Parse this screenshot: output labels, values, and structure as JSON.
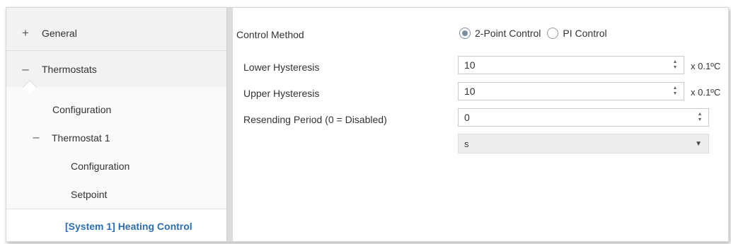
{
  "sidebar": {
    "items": [
      {
        "symbol": "+",
        "label": "General"
      },
      {
        "symbol": "–",
        "label": "Thermostats"
      }
    ],
    "subitems": [
      {
        "label": "Configuration"
      },
      {
        "symbol": "–",
        "label": "Thermostat 1"
      },
      {
        "label": "Configuration"
      },
      {
        "label": "Setpoint"
      },
      {
        "label": "[System 1] Heating Control"
      }
    ]
  },
  "form": {
    "control_method": {
      "label": "Control Method",
      "options": [
        "2-Point Control",
        "PI Control"
      ],
      "selected": "2-Point Control"
    },
    "lower_hysteresis": {
      "label": "Lower Hysteresis",
      "value": "10",
      "unit": "x 0.1ºC"
    },
    "upper_hysteresis": {
      "label": "Upper Hysteresis",
      "value": "10",
      "unit": "x 0.1ºC"
    },
    "resending_period": {
      "label": "Resending Period (0 = Disabled)",
      "value": "0",
      "unit_select": "s"
    }
  },
  "icons": {
    "spin_up": "▲",
    "spin_down": "▼",
    "dropdown": "▼"
  },
  "colors": {
    "selected_item_text": "#2a6fb5",
    "sidebar_bg": "#f2f2f2",
    "radio_dot": "#7b8da1"
  }
}
